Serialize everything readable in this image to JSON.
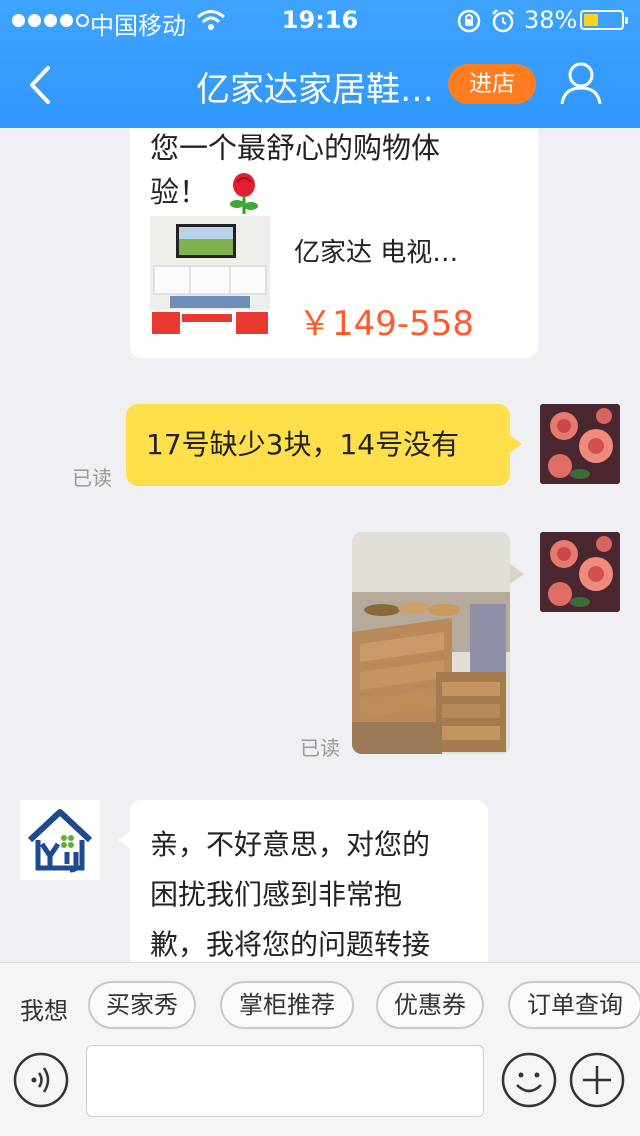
{
  "status_bar": {
    "carrier": "中国移动",
    "time": "19:16",
    "battery_percent": "38%",
    "battery_level": 0.38,
    "signal_bars_filled": 4,
    "signal_bars_total": 5
  },
  "nav": {
    "title": "亿家达家居鞋…",
    "enter_store": "进店",
    "back_icon": "chevron-left-icon",
    "profile_icon": "person-icon"
  },
  "chat": {
    "card": {
      "text_line1": "您一个最舒心的购物体",
      "text_line2": "验！",
      "product_title": "亿家达 电视…",
      "product_price": "￥149-558"
    },
    "message_1": {
      "text": "17号缺少3块，14号没有",
      "status": "已读"
    },
    "message_2": {
      "status": "已读"
    },
    "message_3": {
      "line1": "亲，不好意思，对您的",
      "line2": "困扰我们感到非常抱",
      "line3": "歉，我将您的问题转接"
    }
  },
  "bottom": {
    "quick_label": "我想",
    "chips": [
      "买家秀",
      "掌柜推荐",
      "优惠券",
      "订单查询"
    ],
    "input_placeholder": ""
  },
  "colors": {
    "nav_blue": "#3ca0ff",
    "enter_store_orange": "#ff7c1f",
    "bubble_yellow": "#ffe04a",
    "price_red": "#ff5a2a",
    "battery_yellow": "#ffd21e"
  }
}
